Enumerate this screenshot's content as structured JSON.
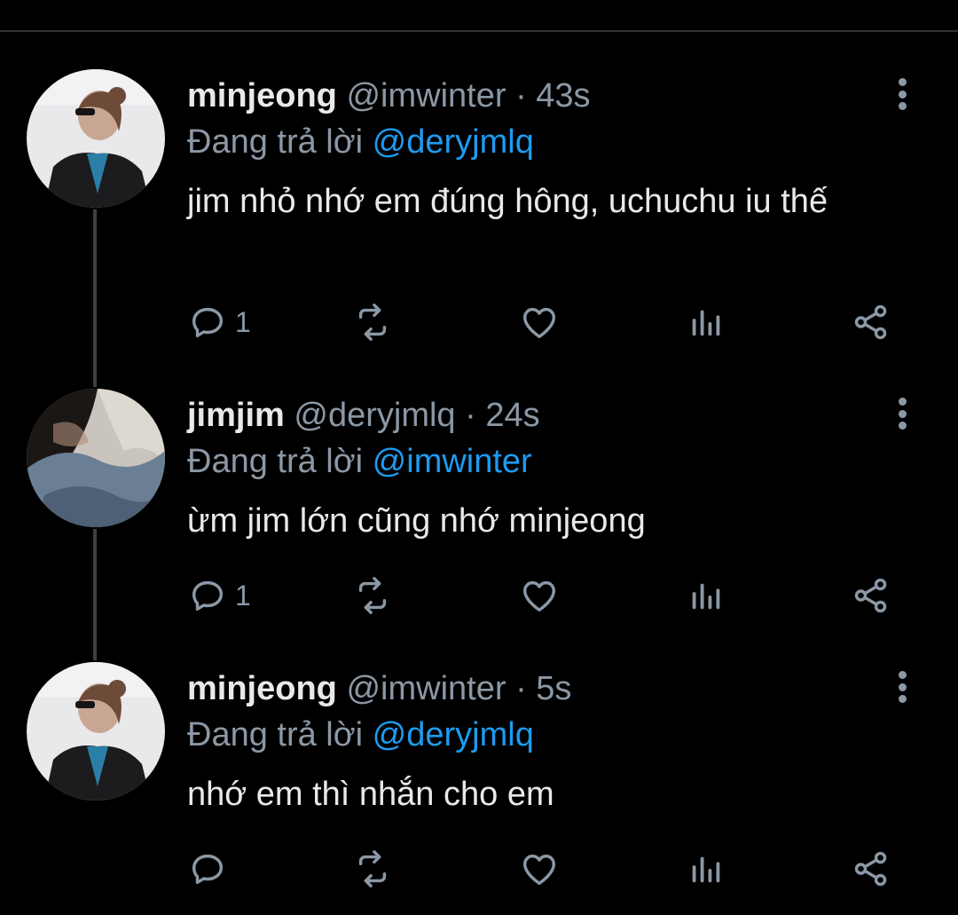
{
  "reply_prefix": "Đang trả lời",
  "tweets": [
    {
      "name": "minjeong",
      "handle": "@imwinter",
      "sep": "·",
      "time": "43s",
      "reply_to": "@deryjmlq",
      "text": "jim nhỏ nhớ em đúng hông, uchuchu iu thế",
      "reply_count": "1"
    },
    {
      "name": "jimjim",
      "handle": "@deryjmlq",
      "sep": "·",
      "time": "24s",
      "reply_to": "@imwinter",
      "text": "ừm jim lớn cũng nhớ minjeong",
      "reply_count": "1"
    },
    {
      "name": "minjeong",
      "handle": "@imwinter",
      "sep": "·",
      "time": "5s",
      "reply_to": "@deryjmlq",
      "text": "nhớ em thì nhắn cho em",
      "reply_count": ""
    }
  ],
  "colors": {
    "background": "#000000",
    "primary_text": "#e7e9ea",
    "secondary_text": "#8b98a5",
    "mention": "#1d9bf0",
    "thread_line": "#3b4148"
  },
  "icons": [
    "reply-icon",
    "retweet-icon",
    "like-icon",
    "analytics-icon",
    "share-icon",
    "more-icon"
  ]
}
